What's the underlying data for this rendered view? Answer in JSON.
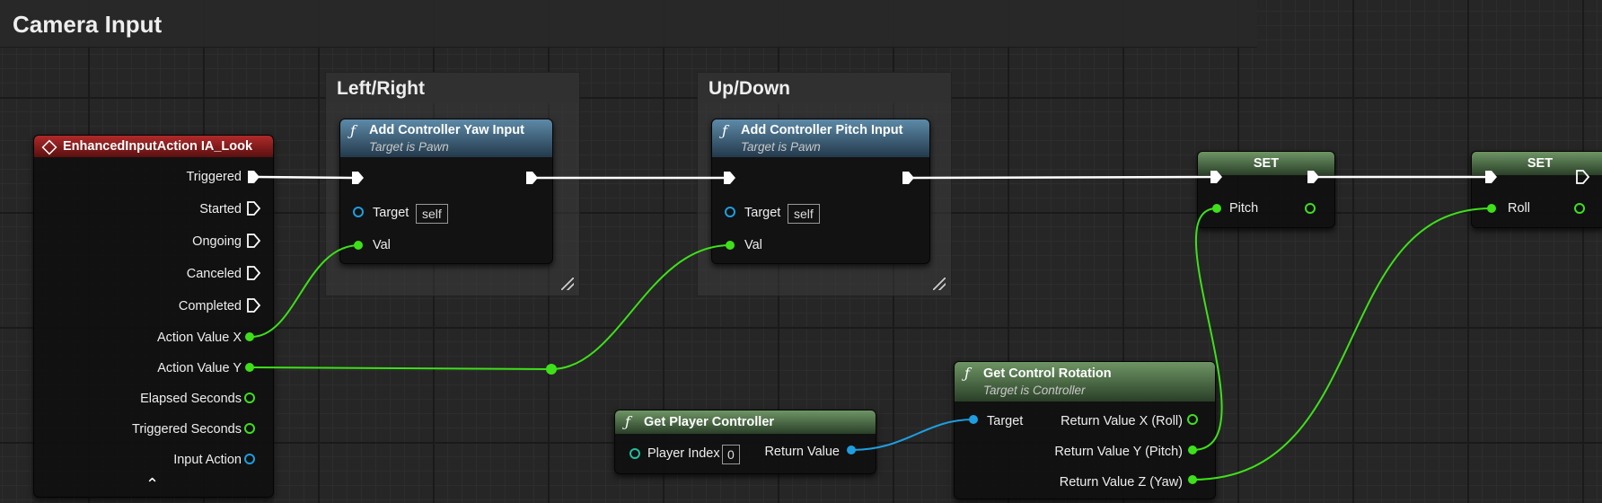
{
  "graph": {
    "comment_main": "Camera Input",
    "comment_left_right": "Left/Right",
    "comment_up_down": "Up/Down"
  },
  "enhanced_input_node": {
    "title": "EnhancedInputAction IA_Look",
    "pins": [
      "Triggered",
      "Started",
      "Ongoing",
      "Canceled",
      "Completed",
      "Action Value X",
      "Action Value Y",
      "Elapsed Seconds",
      "Triggered Seconds",
      "Input Action"
    ],
    "expand_glyph": "⌃"
  },
  "yaw_node": {
    "title": "Add Controller Yaw Input",
    "subtitle": "Target is Pawn",
    "target_label": "Target",
    "target_value": "self",
    "val_label": "Val"
  },
  "pitch_node": {
    "title": "Add Controller Pitch Input",
    "subtitle": "Target is Pawn",
    "target_label": "Target",
    "target_value": "self",
    "val_label": "Val"
  },
  "set_pitch_node": {
    "title": "SET",
    "pin_label": "Pitch"
  },
  "set_roll_node": {
    "title": "SET",
    "pin_label": "Roll"
  },
  "get_player_controller": {
    "title": "Get Player Controller",
    "player_index_label": "Player Index",
    "player_index_value": "0",
    "return_label": "Return Value"
  },
  "get_control_rotation": {
    "title": "Get Control Rotation",
    "subtitle": "Target is Controller",
    "target_label": "Target",
    "out_x": "Return Value X (Roll)",
    "out_y": "Return Value Y (Pitch)",
    "out_z": "Return Value Z (Yaw)"
  },
  "colors": {
    "exec_wire": "#ffffff",
    "float_pin": "#3ee01a",
    "object_pin": "#1e9ee0",
    "event_header": "#a82424",
    "function_header": "#4e7391",
    "pure_header": "#5f8a57"
  }
}
